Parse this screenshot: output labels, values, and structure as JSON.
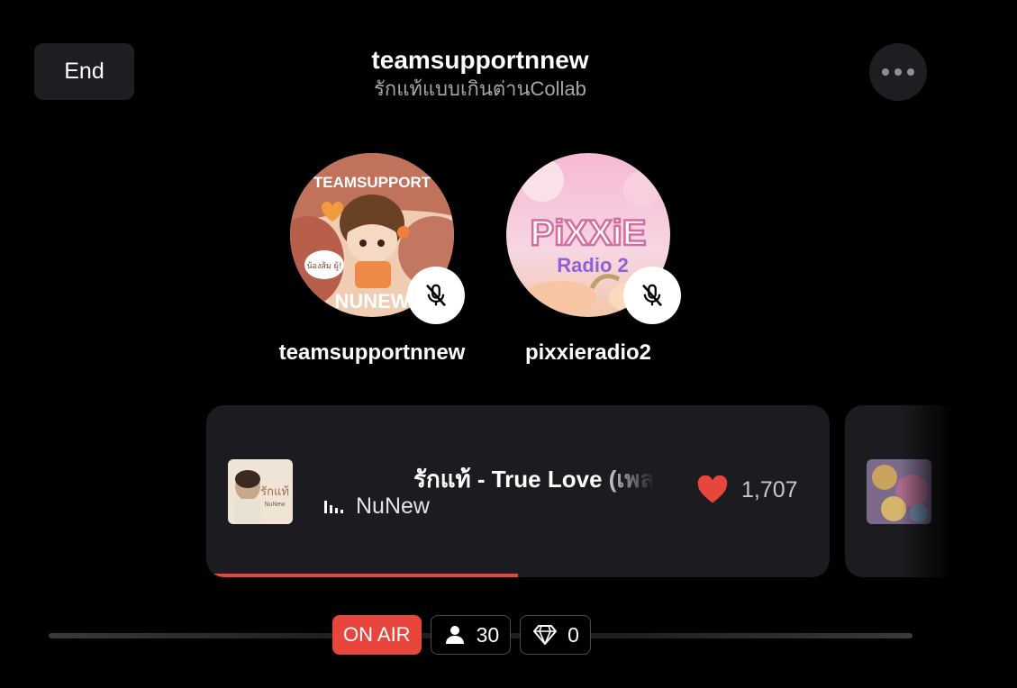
{
  "header": {
    "end_label": "End",
    "title": "teamsupportnnew",
    "subtitle": "รักแท้แบบเกินต่านCollab"
  },
  "hosts": [
    {
      "name": "teamsupportnnew",
      "avatar_text_top": "TEAMSUPPORT",
      "avatar_text_bottom": "NUNEW",
      "avatar_bubble": "น้องส้ม ผู้!",
      "muted": true
    },
    {
      "name": "pixxieradio2",
      "avatar_text_top": "PiXXiE",
      "avatar_text_bottom": "Radio 2",
      "muted": true
    }
  ],
  "now_playing": {
    "title": "รักแท้ - True Love (เพลงประกอบ",
    "artist": "NuNew",
    "likes": "1,707",
    "album_text": "รักแท้",
    "album_sub": "NuNew",
    "progress": 0.5
  },
  "status": {
    "on_air_label": "ON AIR",
    "listeners": "30",
    "diamonds": "0"
  },
  "colors": {
    "accent": "#e8453c",
    "card": "#1c1c20",
    "button": "#1e1e22"
  },
  "icons": [
    "dots-icon",
    "mic-off-icon",
    "equalizer-icon",
    "heart-icon",
    "person-icon",
    "diamond-icon"
  ]
}
